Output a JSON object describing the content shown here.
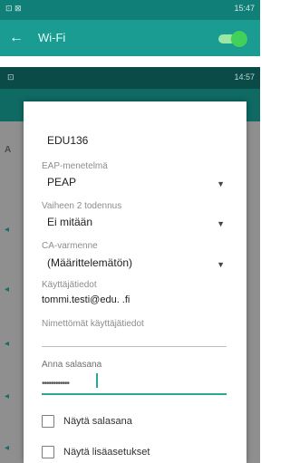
{
  "top": {
    "status_left": "⊡ ⊠",
    "status_right": "15:47",
    "back_icon": "arrow-left-icon",
    "title": "Wi-Fi",
    "wifi_enabled": true
  },
  "second": {
    "status_left": "⊡",
    "status_right": "14:57",
    "behind_letter": "A"
  },
  "dialog": {
    "ssid": "EDU136",
    "eap_label": "EAP-menetelmä",
    "eap_value": "PEAP",
    "phase2_label": "Vaiheen 2 todennus",
    "phase2_value": "Ei mitään",
    "ca_label": "CA-varmenne",
    "ca_value": "(Määrittelemätön)",
    "identity_label": "Käyttäjätiedot",
    "identity_value": "tommi.testi@edu.            .fi",
    "anon_placeholder": "Nimettömät käyttäjätiedot",
    "password_label": "Anna salasana",
    "password_masked": "••••••••••••",
    "show_password_label": "Näytä salasana",
    "show_password_checked": false,
    "show_advanced_label": "Näytä lisäasetukset",
    "show_advanced_checked": false
  },
  "colors": {
    "accent": "#29a69a",
    "appbar": "#1b9c92",
    "toggle_on": "#41d15b"
  }
}
